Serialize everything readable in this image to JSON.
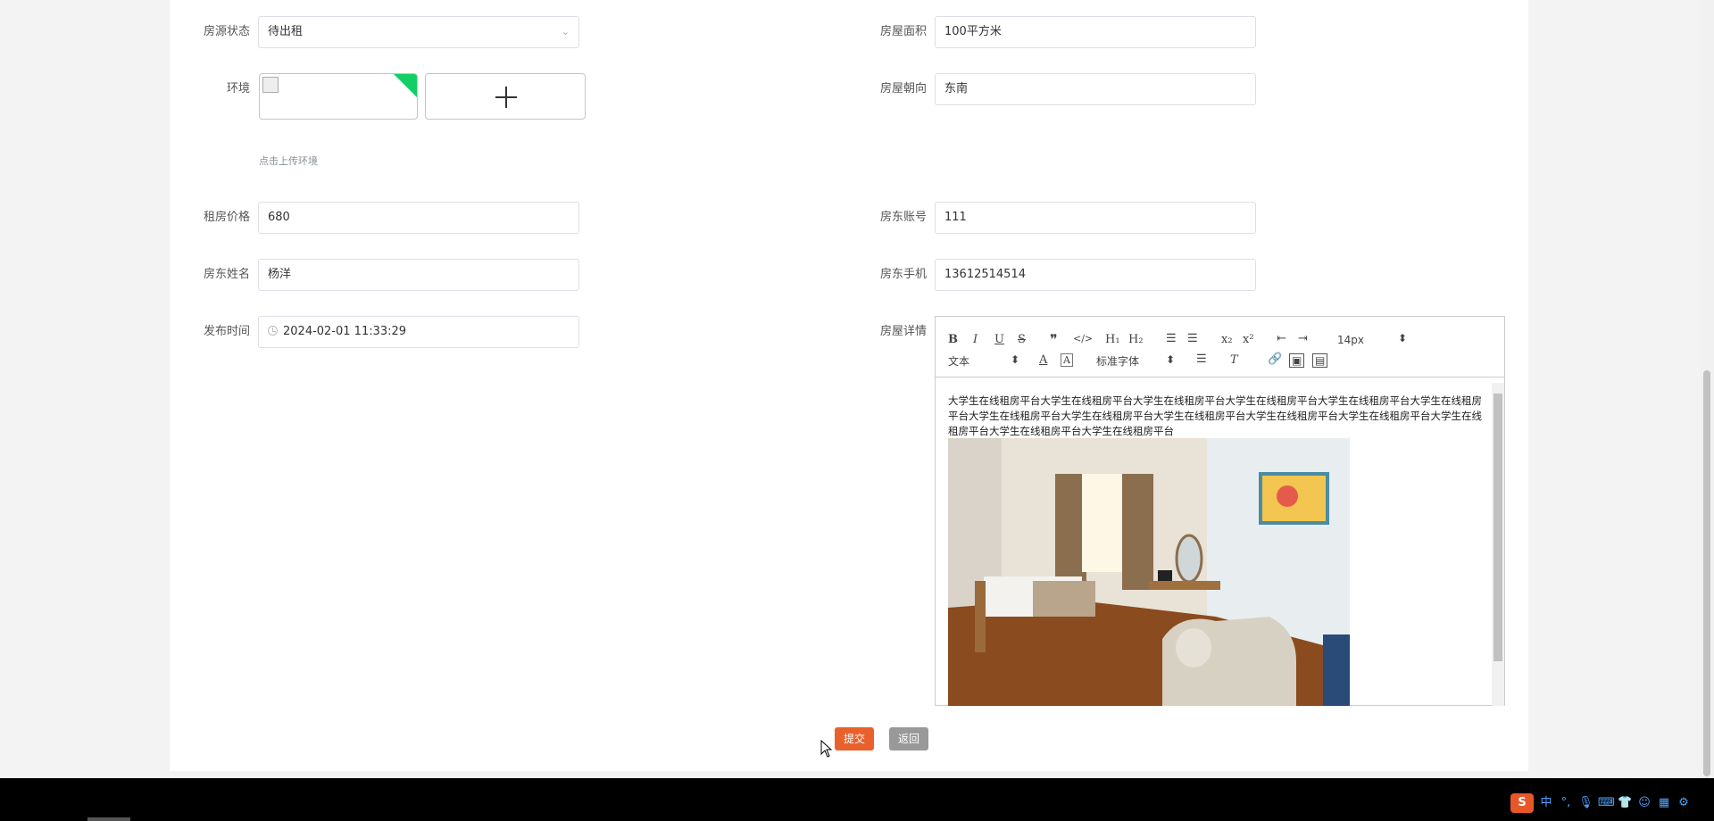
{
  "form": {
    "status": {
      "label": "房源状态",
      "value": "待出租"
    },
    "area": {
      "label": "房屋面积",
      "value": "100平方米"
    },
    "environment": {
      "label": "环境",
      "hint": "点击上传环境"
    },
    "orientation": {
      "label": "房屋朝向",
      "value": "东南"
    },
    "price": {
      "label": "租房价格",
      "value": "680"
    },
    "landlord_account": {
      "label": "房东账号",
      "value": "111"
    },
    "landlord_name": {
      "label": "房东姓名",
      "value": "杨洋"
    },
    "landlord_phone": {
      "label": "房东手机",
      "value": "13612514514"
    },
    "publish_time": {
      "label": "发布时间",
      "value": "2024-02-01 11:33:29"
    },
    "details": {
      "label": "房屋详情"
    }
  },
  "editor": {
    "font_size": "14px",
    "header_select": "文本",
    "font_select": "标准字体",
    "content": "大学生在线租房平台大学生在线租房平台大学生在线租房平台大学生在线租房平台大学生在线租房平台大学生在线租房平台大学生在线租房平台大学生在线租房平台大学生在线租房平台大学生在线租房平台大学生在线租房平台大学生在线租房平台大学生在线租房平台大学生在线租房平台"
  },
  "actions": {
    "submit": "提交",
    "back": "返回"
  },
  "colors": {
    "primary": "#e8612c",
    "back": "#999999",
    "accent": "#13ce66"
  },
  "tray": {
    "ime": "中"
  }
}
